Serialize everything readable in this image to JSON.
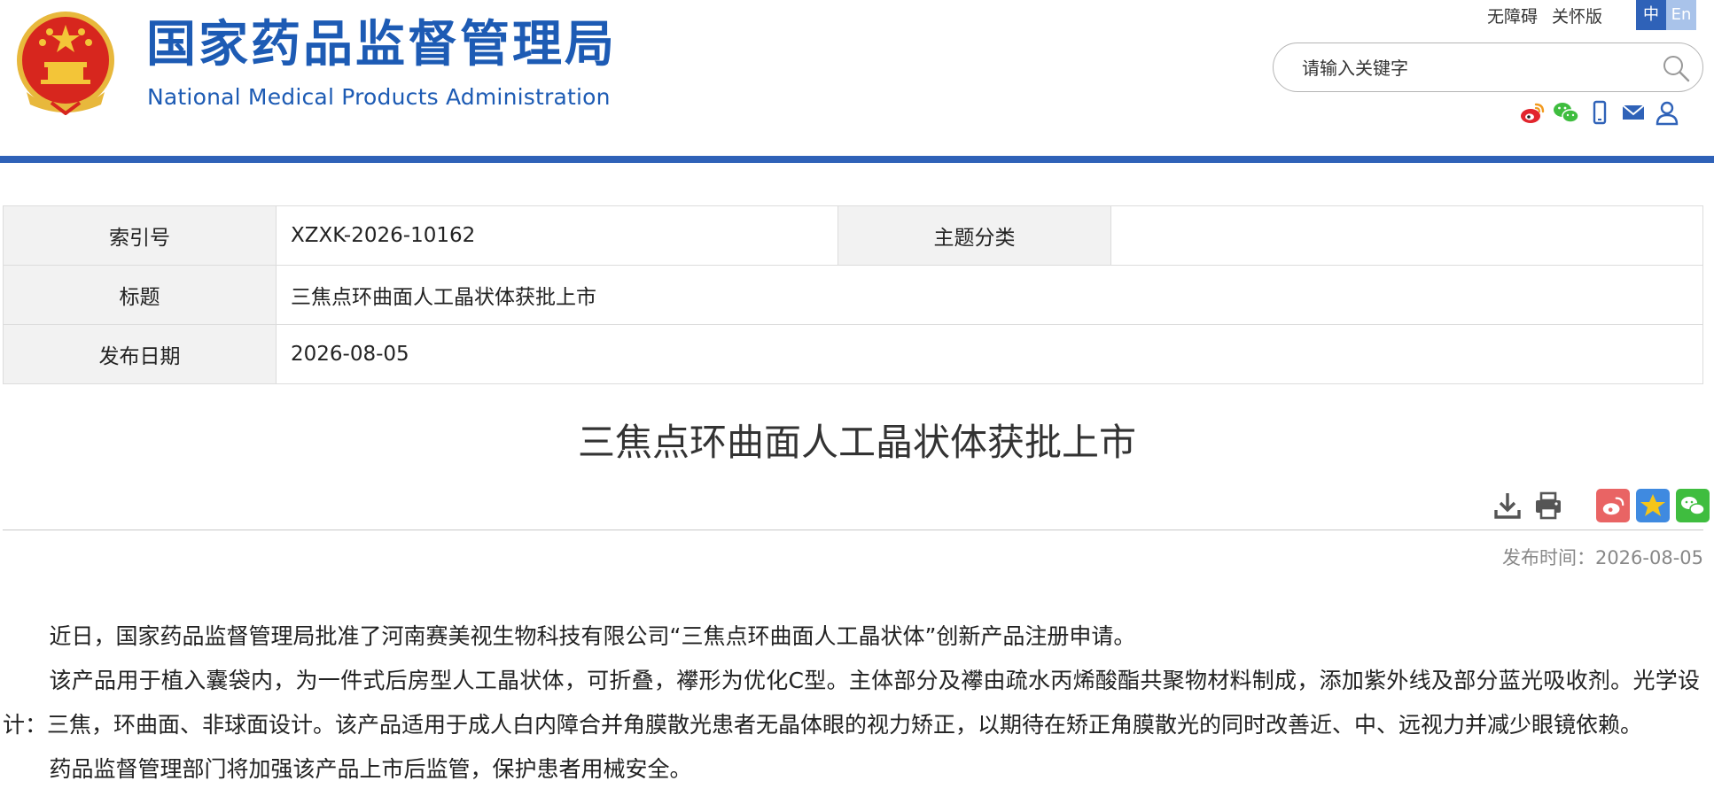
{
  "header": {
    "title_cn": "国家药品监督管理局",
    "title_en": "National Medical Products Administration",
    "top_links": [
      "无障碍",
      "关怀版"
    ],
    "lang": {
      "zh": "中",
      "en": "En",
      "active": "zh"
    },
    "search": {
      "placeholder": "请输入关键字"
    },
    "social_icons": [
      "weibo-icon",
      "wechat-icon",
      "mobile-icon",
      "mail-icon",
      "user-icon"
    ],
    "brand_color": "#1d5bb4",
    "accent_bar_color": "#2f62b8"
  },
  "meta": {
    "index_label": "索引号",
    "index_value": "XZXK-2026-10162",
    "topic_label": "主题分类",
    "topic_value": "",
    "title_label": "标题",
    "title_value": "三焦点环曲面人工晶状体获批上市",
    "date_label": "发布日期",
    "date_value": "2026-08-05"
  },
  "article": {
    "title": "三焦点环曲面人工晶状体获批上市",
    "tool_icons": [
      "download-icon",
      "print-icon"
    ],
    "share_icons": [
      {
        "name": "weibo-share-icon",
        "color": "#e96464"
      },
      {
        "name": "favorite-star-icon",
        "color": "#3f8ae0"
      },
      {
        "name": "wechat-share-icon",
        "color": "#3fbd3f"
      }
    ],
    "publish_time": "发布时间：2026-08-05",
    "paragraphs": [
      "近日，国家药品监督管理局批准了河南赛美视生物科技有限公司“三焦点环曲面人工晶状体”创新产品注册申请。",
      "该产品用于植入囊袋内，为一件式后房型人工晶状体，可折叠，襻形为优化C型。主体部分及襻由疏水丙烯酸酯共聚物材料制成，添加紫外线及部分蓝光吸收剂。光学设计：三焦，环曲面、非球面设计。该产品适用于成人白内障合并角膜散光患者无晶体眼的视力矫正，以期待在矫正角膜散光的同时改善近、中、远视力并减少眼镜依赖。",
      "药品监督管理部门将加强该产品上市后监管，保护患者用械安全。"
    ]
  }
}
